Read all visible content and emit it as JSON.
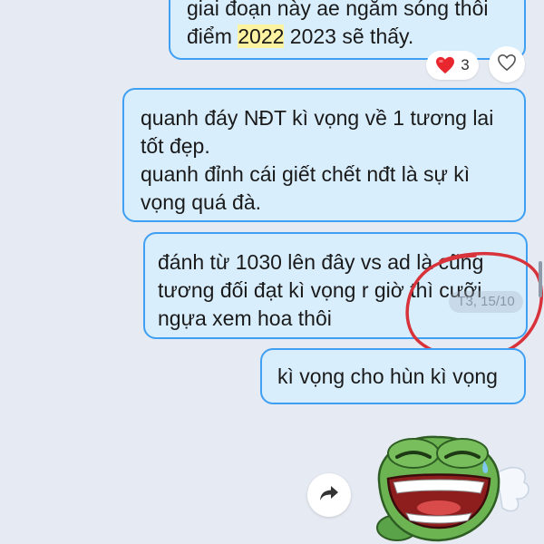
{
  "messages": [
    {
      "lines": [
        {
          "segments": [
            "giai đoạn này ae ngắm sóng thôi"
          ]
        },
        {
          "segments": [
            "điểm ",
            "2022",
            " 2023 sẽ thấy."
          ]
        }
      ]
    },
    {
      "lines": [
        "quanh đáy NĐT kì vọng về 1 tương lai",
        "tốt đẹp.",
        "quanh đỉnh cái giết chết nđt là sự kì",
        "vọng quá đà."
      ]
    },
    {
      "lines": [
        "đánh từ 1030 lên đây vs ad là cũng",
        "tương đối đạt kì vọng r giờ thì cưỡi",
        "ngựa xem hoa thôi"
      ],
      "timestamp": "T3, 15/10"
    },
    {
      "lines": [
        "kì vọng cho hùn kì vọng"
      ]
    }
  ],
  "reaction": {
    "emoji_icon": "heart-icon",
    "count": "3"
  },
  "colors": {
    "bubble_bg": "#d9eefd",
    "bubble_border": "#3f9ff2",
    "highlight": "#fdf3a0",
    "annotation_circle": "#d8323a",
    "chat_bg": "#e6eaf2"
  },
  "icons": {
    "react_button": "heart-outline-icon",
    "forward_button": "forward-arrow-icon",
    "sticker": "laughing-frog-sticker"
  }
}
